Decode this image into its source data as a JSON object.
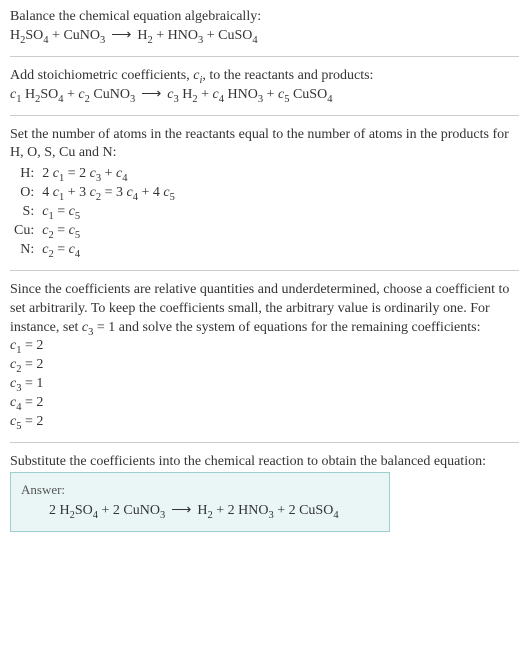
{
  "intro": {
    "line1": "Balance the chemical equation algebraically:",
    "eq_terms": {
      "r1": "H",
      "r1s": "2",
      "r1b": "SO",
      "r1bs": "4",
      "plus1": " + ",
      "r2": "CuNO",
      "r2s": "3",
      "arrow": "⟶",
      "p1": "H",
      "p1s": "2",
      "plus2": " + ",
      "p2": "HNO",
      "p2s": "3",
      "plus3": " + ",
      "p3": "CuSO",
      "p3s": "4"
    }
  },
  "stoich": {
    "text_a": "Add stoichiometric coefficients, ",
    "ci": "c",
    "ci_sub": "i",
    "text_b": ", to the reactants and products:",
    "c1": "c",
    "c1s": "1",
    "sp1": " H",
    "sp1s": "2",
    "sp1b": "SO",
    "sp1bs": "4",
    "plus1": " + ",
    "c2": "c",
    "c2s": "2",
    "sp2": " CuNO",
    "sp2s": "3",
    "arrow": "⟶",
    "c3": "c",
    "c3s": "3",
    "sp3": " H",
    "sp3s": "2",
    "plus2": " + ",
    "c4": "c",
    "c4s": "4",
    "sp4": " HNO",
    "sp4s": "3",
    "plus3": " + ",
    "c5": "c",
    "c5s": "5",
    "sp5": " CuSO",
    "sp5s": "4"
  },
  "atoms": {
    "intro": "Set the number of atoms in the reactants equal to the number of atoms in the products for H, O, S, Cu and N:",
    "rows": [
      {
        "el": "H:",
        "eq_parts": [
          "2 ",
          "c",
          "1",
          " = 2 ",
          "c",
          "3",
          " + ",
          "c",
          "4"
        ]
      },
      {
        "el": "O:",
        "eq_parts": [
          "4 ",
          "c",
          "1",
          " + 3 ",
          "c",
          "2",
          " = 3 ",
          "c",
          "4",
          " + 4 ",
          "c",
          "5"
        ]
      },
      {
        "el": "S:",
        "eq_parts": [
          "",
          "c",
          "1",
          " = ",
          "c",
          "5",
          ""
        ]
      },
      {
        "el": "Cu:",
        "eq_parts": [
          "",
          "c",
          "2",
          " = ",
          "c",
          "5",
          ""
        ]
      },
      {
        "el": "N:",
        "eq_parts": [
          "",
          "c",
          "2",
          " = ",
          "c",
          "4",
          ""
        ]
      }
    ]
  },
  "choose": {
    "text_a": "Since the coefficients are relative quantities and underdetermined, choose a coefficient to set arbitrarily. To keep the coefficients small, the arbitrary value is ordinarily one. For instance, set ",
    "cvar": "c",
    "csub": "3",
    "text_b": " = 1 and solve the system of equations for the remaining coefficients:",
    "results": [
      {
        "v": "c",
        "s": "1",
        "eq": " = 2"
      },
      {
        "v": "c",
        "s": "2",
        "eq": " = 2"
      },
      {
        "v": "c",
        "s": "3",
        "eq": " = 1"
      },
      {
        "v": "c",
        "s": "4",
        "eq": " = 2"
      },
      {
        "v": "c",
        "s": "5",
        "eq": " = 2"
      }
    ]
  },
  "final": {
    "intro": "Substitute the coefficients into the chemical reaction to obtain the balanced equation:",
    "answer_label": "Answer:",
    "eq": {
      "t1": "2 H",
      "s1": "2",
      "t1b": "SO",
      "s1b": "4",
      "plus1": " + 2 CuNO",
      "s2": "3",
      "arrow": "⟶",
      "t3": "H",
      "s3": "2",
      "plus2": " + 2 HNO",
      "s4": "3",
      "plus3": " + 2 CuSO",
      "s5": "4"
    }
  }
}
